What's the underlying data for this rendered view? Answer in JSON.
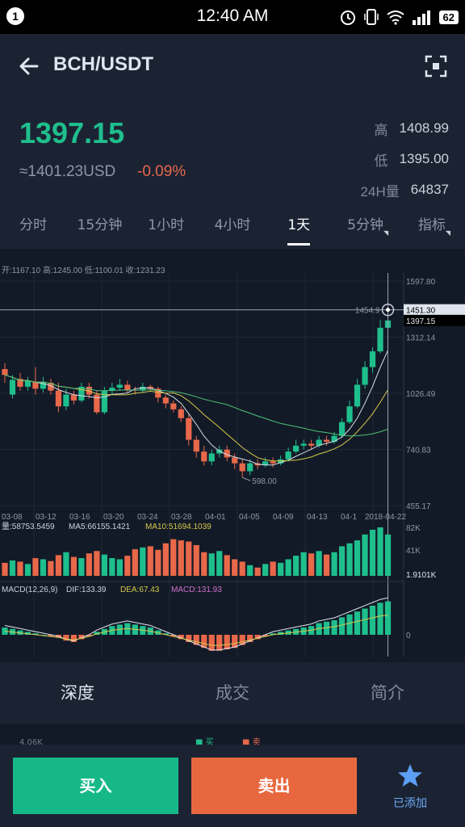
{
  "status": {
    "badge": "1",
    "time": "12:40 AM",
    "battery": "62"
  },
  "header": {
    "pair": "BCH/USDT"
  },
  "price": {
    "last": "1397.15",
    "usd": "≈1401.23USD",
    "change": "-0.09%"
  },
  "stats": [
    {
      "label": "高",
      "value": "1408.99"
    },
    {
      "label": "低",
      "value": "1395.00"
    },
    {
      "label": "24H量",
      "value": "64837"
    }
  ],
  "tabs": [
    "分时",
    "15分钟",
    "1小时",
    "4小时",
    "1天",
    "5分钟",
    "指标"
  ],
  "active_tab": "1天",
  "chart_data": {
    "type": "candlestick",
    "ohlc_label": "开:1167.10 高:1245.00 低:1100.01 收:1231.23",
    "price_ticks": [
      "1597.80",
      "1312.14",
      "1026.49",
      "740.83",
      "455.17"
    ],
    "price_tick_values": [
      1597.8,
      1312.14,
      1026.49,
      740.83,
      455.17
    ],
    "current_price": "1397.15",
    "crosshair_price": "1451.30",
    "crosshair_high_label": "1454.9",
    "low_label": "598.00",
    "dates": [
      "03-08",
      "03-12",
      "03-16",
      "03-20",
      "03-24",
      "03-28",
      "04-01",
      "04-05",
      "04-09",
      "04-13",
      "04-1",
      "2018-04-22"
    ],
    "candles": [
      [
        1150,
        1120,
        1180,
        1080
      ],
      [
        1020,
        1095,
        1120,
        1000
      ],
      [
        1100,
        1060,
        1130,
        1040
      ],
      [
        1060,
        1090,
        1110,
        1040
      ],
      [
        1085,
        1050,
        1160,
        1020
      ],
      [
        1050,
        1085,
        1110,
        1030
      ],
      [
        1080,
        1040,
        1100,
        1020
      ],
      [
        1040,
        960,
        1080,
        930
      ],
      [
        960,
        1020,
        1050,
        940
      ],
      [
        1020,
        990,
        1040,
        970
      ],
      [
        990,
        1060,
        1080,
        980
      ],
      [
        1060,
        1020,
        1080,
        1000
      ],
      [
        1020,
        930,
        1040,
        920
      ],
      [
        930,
        1040,
        1060,
        920
      ],
      [
        1040,
        1055,
        1080,
        1020
      ],
      [
        1055,
        1070,
        1100,
        1040
      ],
      [
        1070,
        1045,
        1090,
        1030
      ],
      [
        1045,
        1040,
        1060,
        1020
      ],
      [
        1040,
        1060,
        1080,
        1030
      ],
      [
        1060,
        1050,
        1070,
        1040
      ],
      [
        1050,
        1005,
        1060,
        980
      ],
      [
        1005,
        975,
        1020,
        950
      ],
      [
        975,
        945,
        990,
        930
      ],
      [
        945,
        900,
        960,
        880
      ],
      [
        900,
        790,
        920,
        760
      ],
      [
        790,
        730,
        810,
        700
      ],
      [
        730,
        680,
        760,
        660
      ],
      [
        680,
        720,
        740,
        660
      ],
      [
        720,
        740,
        760,
        700
      ],
      [
        740,
        700,
        760,
        680
      ],
      [
        700,
        670,
        720,
        640
      ],
      [
        670,
        630,
        690,
        598
      ],
      [
        630,
        670,
        690,
        610
      ],
      [
        670,
        660,
        690,
        640
      ],
      [
        660,
        680,
        700,
        650
      ],
      [
        680,
        670,
        700,
        650
      ],
      [
        670,
        690,
        710,
        660
      ],
      [
        690,
        730,
        750,
        680
      ],
      [
        730,
        760,
        790,
        720
      ],
      [
        760,
        770,
        790,
        740
      ],
      [
        770,
        760,
        790,
        740
      ],
      [
        760,
        790,
        810,
        750
      ],
      [
        790,
        780,
        810,
        760
      ],
      [
        780,
        810,
        830,
        770
      ],
      [
        810,
        880,
        900,
        800
      ],
      [
        880,
        960,
        990,
        870
      ],
      [
        960,
        1070,
        1100,
        950
      ],
      [
        1070,
        1160,
        1190,
        1050
      ],
      [
        1160,
        1240,
        1260,
        1130
      ],
      [
        1240,
        1360,
        1400,
        1230
      ],
      [
        1360,
        1397,
        1454,
        1340
      ]
    ],
    "volume_label": "量:58753.5459",
    "ma5_label": "MA5:66155.1421",
    "ma10_label": "MA10:51694.1039",
    "volume_ticks": [
      "82K",
      "41K"
    ],
    "volume_current": "1.9101K",
    "volumes": [
      22,
      26,
      24,
      20,
      30,
      28,
      25,
      35,
      40,
      32,
      30,
      38,
      42,
      36,
      30,
      28,
      34,
      45,
      48,
      50,
      44,
      55,
      62,
      60,
      58,
      52,
      40,
      38,
      42,
      35,
      28,
      24,
      18,
      14,
      20,
      24,
      22,
      28,
      34,
      40,
      38,
      42,
      36,
      40,
      50,
      55,
      60,
      70,
      78,
      82,
      70
    ],
    "macd_label": "MACD(12,26,9)",
    "dif_label": "DIF:133.39",
    "dea_label": "DEA:67.43",
    "macd_value_label": "MACD:131.93",
    "macd_zero_tick": "0",
    "macd_hist": [
      10,
      8,
      6,
      4,
      2,
      0,
      -2,
      -4,
      -8,
      -10,
      -6,
      -2,
      4,
      8,
      12,
      14,
      16,
      14,
      12,
      10,
      6,
      2,
      -2,
      -6,
      -10,
      -14,
      -18,
      -22,
      -22,
      -20,
      -18,
      -14,
      -10,
      -6,
      -2,
      2,
      4,
      6,
      8,
      10,
      12,
      16,
      18,
      20,
      24,
      28,
      32,
      36,
      40,
      44,
      46
    ]
  },
  "lower_tabs": [
    "深度",
    "成交",
    "简介"
  ],
  "depth_legend": {
    "left": "4.06K",
    "buy": "买",
    "sell": "卖"
  },
  "actions": {
    "buy": "买入",
    "sell": "卖出",
    "fav": "已添加"
  },
  "colors": {
    "up": "#1fbf8d",
    "down": "#e8684a",
    "ma5": "#d8dde6",
    "ma10": "#d5c94a",
    "ma30": "#4cc27a"
  }
}
